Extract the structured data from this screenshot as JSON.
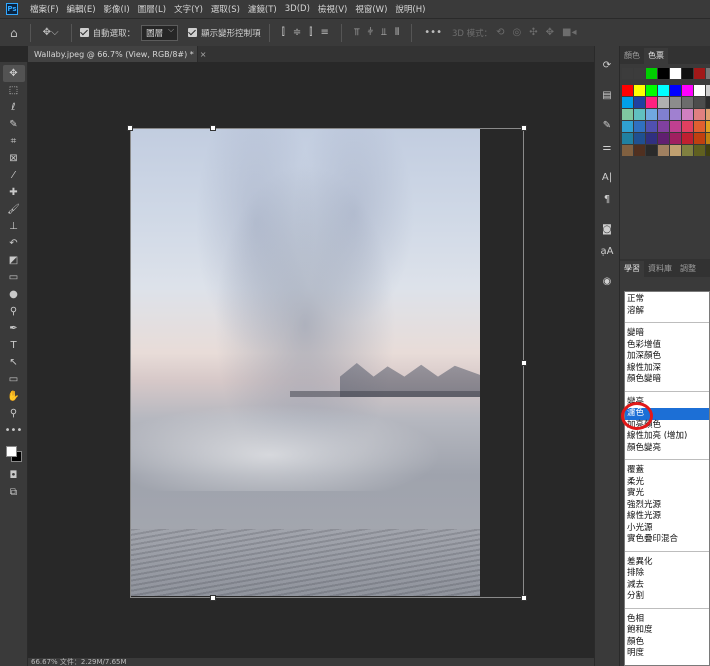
{
  "menubar": {
    "app_badge": "Ps",
    "items": [
      "檔案(F)",
      "編輯(E)",
      "影像(I)",
      "圖層(L)",
      "文字(Y)",
      "選取(S)",
      "濾鏡(T)",
      "3D(D)",
      "檢視(V)",
      "視窗(W)",
      "說明(H)"
    ]
  },
  "options": {
    "auto_select_label": "自動選取：",
    "auto_select_value": "圖層",
    "show_transform_label": "顯示變形控制項",
    "mode_3d_label": "3D 模式："
  },
  "document": {
    "tab_title": "Wallaby.jpeg @ 66.7% (View, RGB/8#) *",
    "close_glyph": "×"
  },
  "status": {
    "text": "66.67%    文件：2.29M/7.65M"
  },
  "color_panel": {
    "tabs": [
      "顏色",
      "色票"
    ],
    "active_tab": 1,
    "swatch_rows": [
      [
        "#3c3c3c",
        "#3c3c3c",
        "#00d000",
        "#000000",
        "#ffffff",
        "#111111",
        "#a01818",
        "#777777"
      ],
      [
        "#ff0000",
        "#ffff00",
        "#00ff00",
        "#00ffff",
        "#0000ff",
        "#ff00ff",
        "#ffffff",
        "#cfcfcf"
      ],
      [
        "#00a0e8",
        "#2040a0",
        "#ff2080",
        "#b0b0b0",
        "#8c8c8c",
        "#6c6c6c",
        "#4c4c4c",
        "#2c2c2c"
      ],
      [
        "#80c8a0",
        "#60c0c0",
        "#70a8e0",
        "#8080d0",
        "#a080d0",
        "#d080c0",
        "#e08080",
        "#e0a070"
      ],
      [
        "#30a0d0",
        "#3070c0",
        "#5050b0",
        "#8040a0",
        "#c04090",
        "#e04060",
        "#e06030",
        "#e0a020"
      ],
      [
        "#2080a0",
        "#205090",
        "#303080",
        "#602070",
        "#a02060",
        "#c02030",
        "#c04010",
        "#c08010"
      ],
      [
        "#806040",
        "#503020",
        "#2a2a2a",
        "#a08060",
        "#c0a070",
        "#808040",
        "#606020",
        "#404010"
      ]
    ]
  },
  "layers_panel": {
    "tabs": [
      "學習",
      "資料庫",
      "調整"
    ],
    "active_tab": 0
  },
  "blend_modes": {
    "groups": [
      [
        "正常",
        "溶解"
      ],
      [
        "變暗",
        "色彩增值",
        "加深顏色",
        "線性加深",
        "顏色變暗"
      ],
      [
        "變亮",
        "濾色",
        "加亮顏色",
        "線性加亮 (增加)",
        "顏色變亮"
      ],
      [
        "覆蓋",
        "柔光",
        "實光",
        "強烈光源",
        "線性光源",
        "小光源",
        "實色疊印混合"
      ],
      [
        "差異化",
        "排除",
        "減去",
        "分割"
      ],
      [
        "色相",
        "飽和度",
        "顏色",
        "明度"
      ]
    ],
    "selected": "濾色"
  },
  "colors": {
    "selection_blue": "#1c6fd6",
    "highlight_circle": "#e11919",
    "foreground": "#ffffff",
    "background": "#000000"
  },
  "tool_icons": [
    "move-tool-icon",
    "marquee-tool-icon",
    "lasso-tool-icon",
    "quick-select-icon",
    "crop-tool-icon",
    "frame-tool-icon",
    "eyedropper-icon",
    "healing-brush-icon",
    "brush-tool-icon",
    "clone-stamp-icon",
    "history-brush-icon",
    "eraser-icon",
    "gradient-icon",
    "blur-icon",
    "dodge-icon",
    "pen-tool-icon",
    "type-tool-icon",
    "path-select-icon",
    "rectangle-tool-icon",
    "hand-tool-icon",
    "zoom-tool-icon",
    "more-tools-icon"
  ]
}
